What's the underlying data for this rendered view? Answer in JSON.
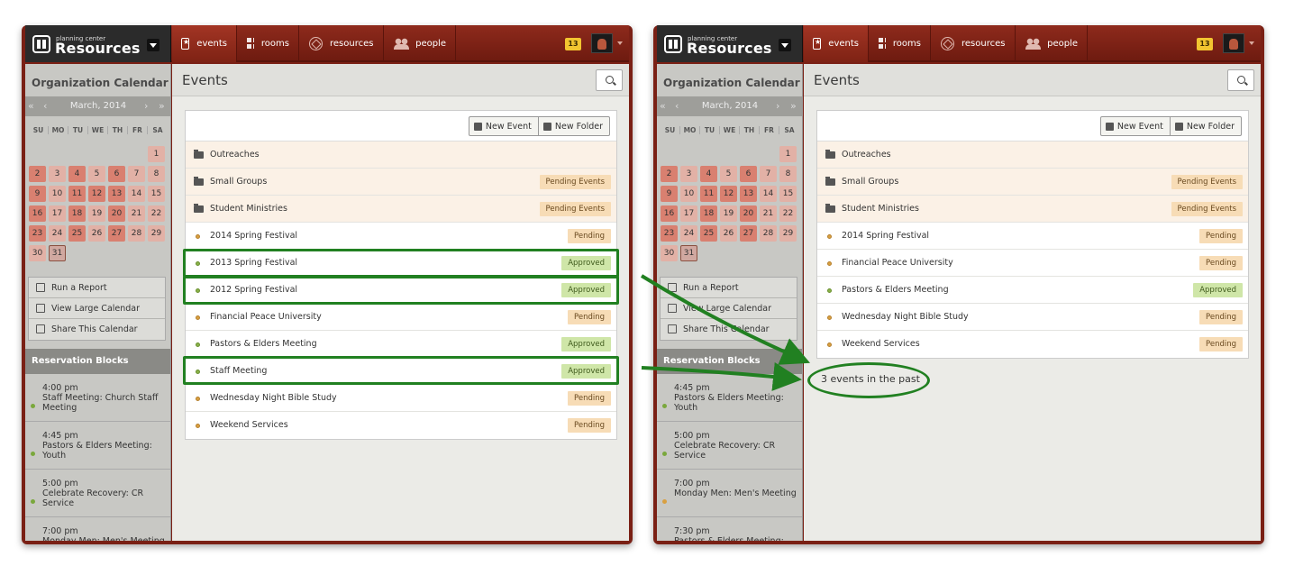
{
  "header": {
    "logo_small": "planning center",
    "logo_big": "Resources",
    "nav": [
      "events",
      "rooms",
      "resources",
      "people"
    ],
    "badge": "13"
  },
  "sidebar": {
    "title": "Organization Calendar",
    "month": "March, 2014",
    "dow": [
      "SU",
      "MO",
      "TU",
      "WE",
      "TH",
      "FR",
      "SA"
    ],
    "days": [
      "1",
      "2",
      "3",
      "4",
      "5",
      "6",
      "7",
      "8",
      "9",
      "10",
      "11",
      "12",
      "13",
      "14",
      "15",
      "16",
      "17",
      "18",
      "19",
      "20",
      "21",
      "22",
      "23",
      "24",
      "25",
      "26",
      "27",
      "28",
      "29",
      "30",
      "31"
    ],
    "actions": [
      "Run a Report",
      "View Large Calendar",
      "Share This Calendar"
    ],
    "reservation_heading": "Reservation Blocks"
  },
  "left": {
    "title": "Events",
    "new_event": "New Event",
    "new_folder": "New Folder",
    "rows": [
      {
        "name": "Outreaches",
        "status": ""
      },
      {
        "name": "Small Groups",
        "status": "Pending Events"
      },
      {
        "name": "Student Ministries",
        "status": "Pending Events"
      },
      {
        "name": "2014 Spring Festival",
        "status": "Pending"
      },
      {
        "name": "2013 Spring Festival",
        "status": "Approved"
      },
      {
        "name": "2012 Spring Festival",
        "status": "Approved"
      },
      {
        "name": "Financial Peace University",
        "status": "Pending"
      },
      {
        "name": "Pastors & Elders Meeting",
        "status": "Approved"
      },
      {
        "name": "Staff Meeting",
        "status": "Approved"
      },
      {
        "name": "Wednesday Night Bible Study",
        "status": "Pending"
      },
      {
        "name": "Weekend Services",
        "status": "Pending"
      }
    ],
    "reservations": [
      {
        "time": "4:00 pm",
        "title": "Staff Meeting: Church Staff Meeting"
      },
      {
        "time": "4:45 pm",
        "title": "Pastors & Elders Meeting: Youth"
      },
      {
        "time": "5:00 pm",
        "title": "Celebrate Recovery: CR Service"
      },
      {
        "time": "7:00 pm",
        "title": "Monday Men: Men's Meeting"
      }
    ]
  },
  "right": {
    "title": "Events",
    "new_event": "New Event",
    "new_folder": "New Folder",
    "rows": [
      {
        "name": "Outreaches",
        "status": ""
      },
      {
        "name": "Small Groups",
        "status": "Pending Events"
      },
      {
        "name": "Student Ministries",
        "status": "Pending Events"
      },
      {
        "name": "2014 Spring Festival",
        "status": "Pending"
      },
      {
        "name": "Financial Peace University",
        "status": "Pending"
      },
      {
        "name": "Pastors & Elders Meeting",
        "status": "Approved"
      },
      {
        "name": "Wednesday Night Bible Study",
        "status": "Pending"
      },
      {
        "name": "Weekend Services",
        "status": "Pending"
      }
    ],
    "past_text": "3 events in the past",
    "reservations": [
      {
        "time": "4:45 pm",
        "title": "Pastors & Elders Meeting: Youth"
      },
      {
        "time": "5:00 pm",
        "title": "Celebrate Recovery: CR Service"
      },
      {
        "time": "7:00 pm",
        "title": "Monday Men: Men's Meeting"
      },
      {
        "time": "7:30 pm",
        "title": "Pastors & Elders Meeting:"
      }
    ]
  },
  "colors": {
    "brand": "#7a2015",
    "highlight": "#218021",
    "pending": "#f7dcb6",
    "approved": "#cfe6a8"
  }
}
